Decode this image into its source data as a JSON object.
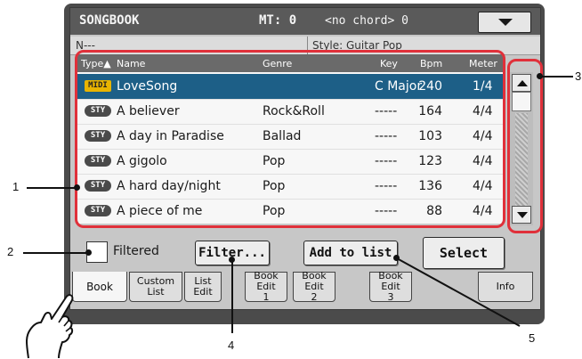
{
  "topbar": {
    "title": "SONGBOOK",
    "mt": "MT: 0",
    "chord": "<no chord> 0"
  },
  "info": {
    "name": "N---",
    "style": "Style: Guitar Pop"
  },
  "columns": {
    "type": "Type▲",
    "name": "Name",
    "genre": "Genre",
    "key": "Key",
    "bpm": "Bpm",
    "meter": "Meter"
  },
  "rows": [
    {
      "type": "MIDI",
      "name": "LoveSong",
      "genre": "",
      "key": "C Major",
      "bpm": "240",
      "meter": "1/4",
      "selected": true
    },
    {
      "type": "STY",
      "name": "A believer",
      "genre": "Rock&Roll",
      "key": "-----",
      "bpm": "164",
      "meter": "4/4"
    },
    {
      "type": "STY",
      "name": "A day in Paradise",
      "genre": "Ballad",
      "key": "-----",
      "bpm": "103",
      "meter": "4/4"
    },
    {
      "type": "STY",
      "name": "A gigolo",
      "genre": "Pop",
      "key": "-----",
      "bpm": "123",
      "meter": "4/4"
    },
    {
      "type": "STY",
      "name": "A hard day/night",
      "genre": "Pop",
      "key": "-----",
      "bpm": "136",
      "meter": "4/4"
    },
    {
      "type": "STY",
      "name": "A piece of me",
      "genre": "Pop",
      "key": "-----",
      "bpm": "88",
      "meter": "4/4"
    }
  ],
  "controls": {
    "filtered_label": "Filtered",
    "filter_button": "Filter...",
    "add_button": "Add to list",
    "select_button": "Select"
  },
  "tabs": [
    {
      "label": "Book",
      "active": true
    },
    {
      "label": "Custom List"
    },
    {
      "label": "List Edit"
    },
    {
      "label": "Book Edit 1"
    },
    {
      "label": "Book Edit 2"
    },
    {
      "label": "Book Edit 3"
    },
    {
      "label": "Info"
    }
  ],
  "callouts": [
    "1",
    "2",
    "3",
    "4",
    "5"
  ],
  "colors": {
    "selected_row": "#1d5f87",
    "annotation": "#e0303a",
    "midi_badge": "#e8b400"
  },
  "icons": {
    "menu": "triangle-down-icon",
    "scroll_up": "arrow-up-icon",
    "scroll_down": "arrow-down-icon",
    "hand": "pointing-hand-icon"
  }
}
